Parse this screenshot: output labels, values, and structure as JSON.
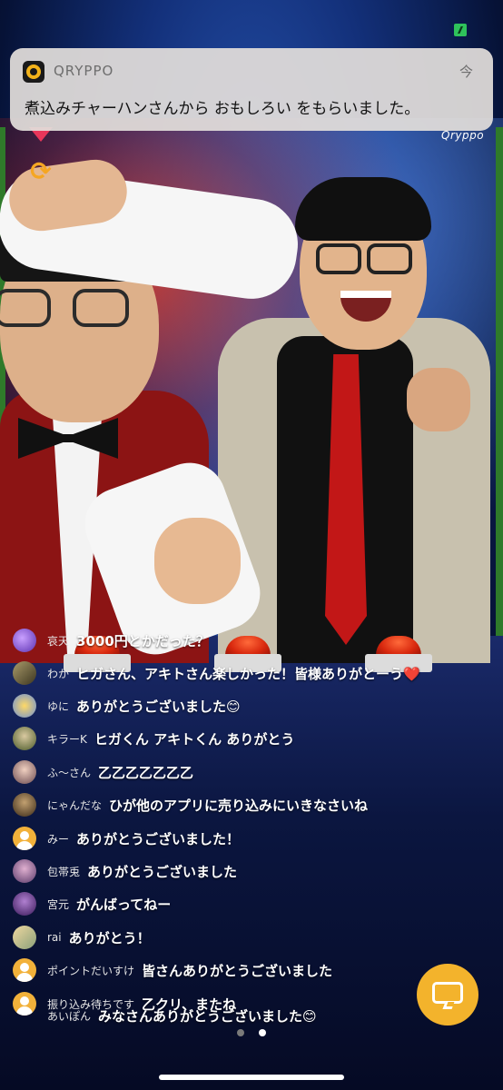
{
  "status_bar": {
    "battery_color": "#2fc25b"
  },
  "notification": {
    "app_name": "QRYPPO",
    "time": "今",
    "message": "煮込みチャーハンさんから おもしろい をもらいました。"
  },
  "stream": {
    "watermark": "Qryppo",
    "rotate_icon": "rotate-icon",
    "accent": "#f3b32c"
  },
  "chat": {
    "messages": [
      {
        "user": "哀天",
        "text": "3000円とかだった？",
        "avatar": "purple-avatar"
      },
      {
        "user": "わか",
        "text": "ヒガさん、アキトさん楽しかった！皆様ありがとーう❤️",
        "avatar": "photo-avatar"
      },
      {
        "user": "ゆに",
        "text": "ありがとうございました😊",
        "avatar": "photo-avatar"
      },
      {
        "user": "キラーK",
        "text": "ヒガくん アキトくん ありがとう",
        "avatar": "photo-avatar"
      },
      {
        "user": "ふ〜さん",
        "text": "乙乙乙乙乙乙乙",
        "avatar": "photo-avatar"
      },
      {
        "user": "にゃんだな",
        "text": "ひが他のアプリに売り込みにいきなさいね",
        "avatar": "photo-avatar"
      },
      {
        "user": "みー",
        "text": "ありがとうございました！",
        "avatar": "default-avatar"
      },
      {
        "user": "包帯兎",
        "text": "ありがとうございました",
        "avatar": "photo-avatar"
      },
      {
        "user": "宮元",
        "text": "がんばってねー",
        "avatar": "photo-avatar"
      },
      {
        "user": "rai",
        "text": "ありがとう！",
        "avatar": "photo-avatar"
      },
      {
        "user": "ポイントだいすけ",
        "text": "皆さんありがとうございました",
        "avatar": "default-avatar"
      },
      {
        "user": "振り込み待ちです",
        "text": "乙クリ、またね",
        "avatar": "default-avatar"
      },
      {
        "user": "あいぽん",
        "text": "みなさんありがとうございました😊",
        "avatar": "default-avatar"
      }
    ]
  },
  "pagination": {
    "current": 2,
    "total": 2
  }
}
